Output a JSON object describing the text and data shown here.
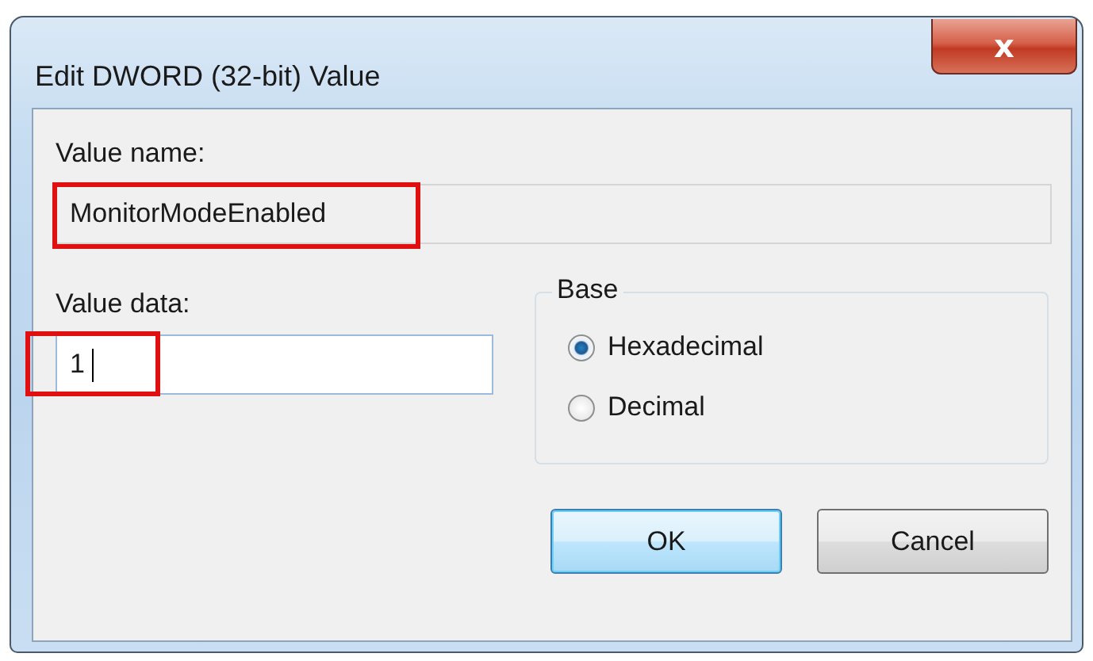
{
  "window": {
    "title": "Edit DWORD (32-bit) Value",
    "close": "x"
  },
  "value_name": {
    "label": "Value name:",
    "value": "MonitorModeEnabled",
    "highlighted": true
  },
  "value_data": {
    "label": "Value data:",
    "value": "1",
    "highlighted": true
  },
  "base": {
    "title": "Base",
    "options": [
      {
        "label": "Hexadecimal",
        "selected": true
      },
      {
        "label": "Decimal",
        "selected": false
      }
    ]
  },
  "buttons": [
    {
      "label": "OK",
      "default": true
    },
    {
      "label": "Cancel",
      "default": false
    }
  ]
}
